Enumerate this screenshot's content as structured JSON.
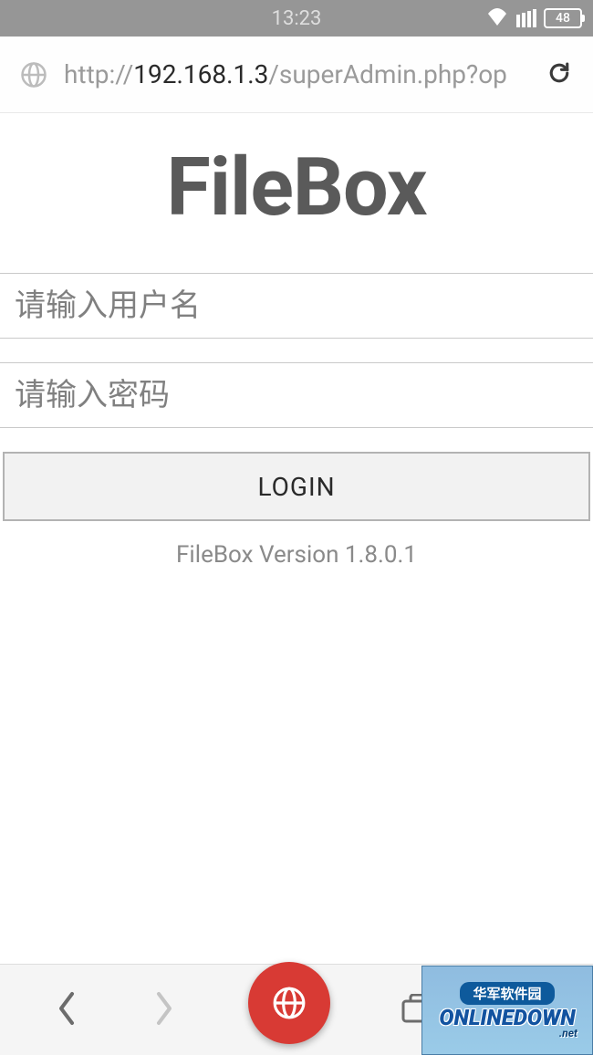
{
  "status_bar": {
    "time": "13:23",
    "battery": "48"
  },
  "url_bar": {
    "prefix": "http://",
    "host": "192.168.1.3",
    "path": "/superAdmin.php?op"
  },
  "page": {
    "title": "FileBox",
    "username_placeholder": "请输入用户名",
    "password_placeholder": "请输入密码",
    "login_label": "LOGIN",
    "version_text": "FileBox Version 1.8.0.1"
  },
  "watermark": {
    "cn": "华军软件园",
    "brand": "ONLINEDOWN",
    "domain": ".net"
  }
}
